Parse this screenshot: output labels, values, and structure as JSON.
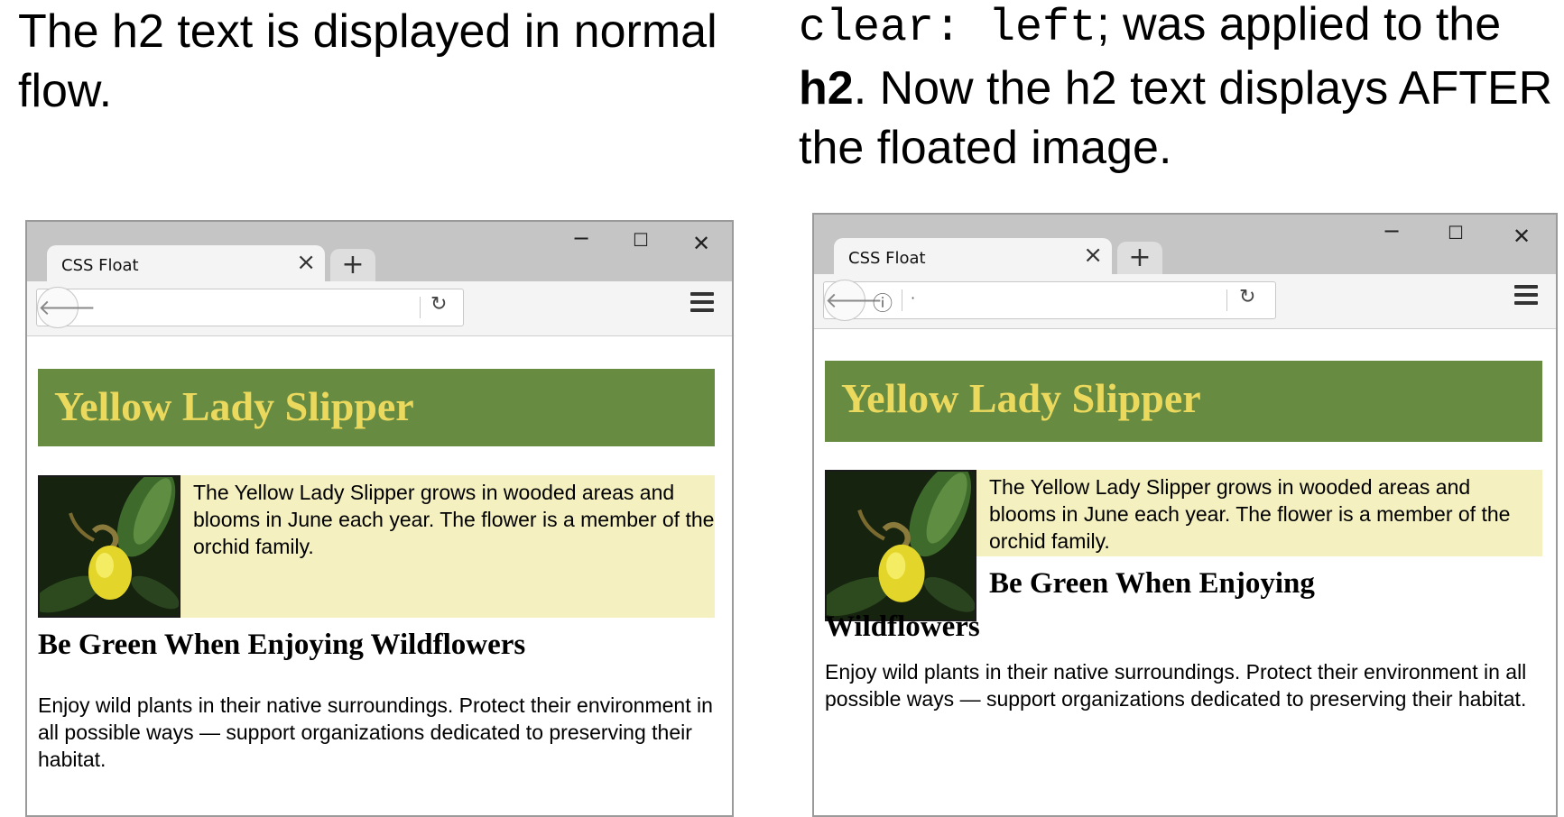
{
  "captions": {
    "left": "The h2 text is displayed in normal flow.",
    "right": {
      "code": "clear: left",
      "part1": "; was applied to the ",
      "bold": "h2",
      "part2": ". Now the h2 text displays AFTER the floated image."
    }
  },
  "browsers": {
    "left": {
      "tab_title": "CSS Float",
      "tab_close": "×",
      "new_tab": "+",
      "win_minimize": "−",
      "win_maximize": "☐",
      "win_close": "✕",
      "back": "🡐",
      "reload": "↻",
      "url": "",
      "heading": "Yellow Lady Slipper",
      "paragraph": "The Yellow Lady Slipper grows in wooded areas and blooms in June each year. The flower is a member of the orchid family.",
      "subheading": "Be Green When Enjoying Wildflowers",
      "body": "Enjoy wild plants in their native surroundings. Protect their environment in all possible ways — support organizations dedicated to preserving their habitat."
    },
    "right": {
      "tab_title": "CSS Float",
      "tab_close": "×",
      "new_tab": "+",
      "win_minimize": "−",
      "win_maximize": "☐",
      "win_close": "✕",
      "back": "🡐",
      "info": "ⓘ",
      "reload": "↻",
      "url": "·",
      "heading": "Yellow Lady Slipper",
      "paragraph": "The Yellow Lady Slipper grows in wooded areas and blooms in June each year. The flower is a member of the orchid family.",
      "subheading": "Be Green When Enjoying Wildflowers",
      "body": "Enjoy wild plants in their native surroundings. Protect their environment in all possible ways — support organizations dedicated to preserving their habitat."
    }
  },
  "colors": {
    "heading_bg": "#688b42",
    "heading_text": "#ebd95e",
    "paragraph_bg": "#f4f0c0"
  },
  "icons": [
    "back-arrow-icon",
    "reload-icon",
    "menu-icon",
    "info-icon",
    "close-icon",
    "plus-icon",
    "minimize-icon",
    "maximize-icon"
  ]
}
